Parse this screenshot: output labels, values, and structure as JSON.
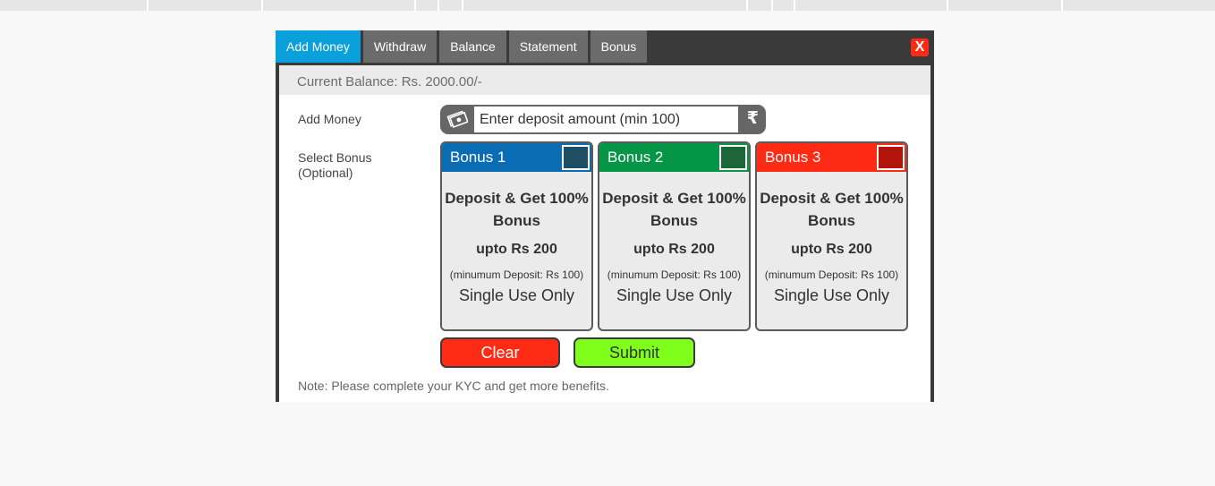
{
  "tabs": [
    {
      "label": "Add Money",
      "active": true
    },
    {
      "label": "Withdraw"
    },
    {
      "label": "Balance"
    },
    {
      "label": "Statement"
    },
    {
      "label": "Bonus"
    }
  ],
  "close_label": "X",
  "balance_text": "Current Balance: Rs. 2000.00/-",
  "form": {
    "add_money_label": "Add Money",
    "amount_placeholder": "Enter deposit amount (min 100)",
    "currency_symbol": "₹",
    "select_bonus_label_line1": "Select Bonus",
    "select_bonus_label_line2": "(Optional)"
  },
  "bonuses": [
    {
      "title": "Bonus 1",
      "line1": "Deposit & Get 100%",
      "line2": "Bonus",
      "upto": "upto Rs 200",
      "min": "(minumum Deposit: Rs 100)",
      "usage": "Single Use Only",
      "header_color": "#0a6db4",
      "check_color": "#1d4e63"
    },
    {
      "title": "Bonus 2",
      "line1": "Deposit & Get 100%",
      "line2": "Bonus",
      "upto": "upto Rs 200",
      "min": "(minumum Deposit: Rs 100)",
      "usage": "Single Use Only",
      "header_color": "#059547",
      "check_color": "#1c6638"
    },
    {
      "title": "Bonus 3",
      "line1": "Deposit & Get 100%",
      "line2": "Bonus",
      "upto": "upto Rs 200",
      "min": "(minumum Deposit: Rs 100)",
      "usage": "Single Use Only",
      "header_color": "#ff2a14",
      "check_color": "#b3140a"
    }
  ],
  "buttons": {
    "clear": "Clear",
    "submit": "Submit"
  },
  "note": "Note: Please complete your KYC and get more benefits.",
  "colors": {
    "active_tab": "#0aa0dc",
    "tab": "#6b6b6b",
    "modal_bg": "#3a3a3a",
    "clear": "#ff2b14",
    "submit": "#7fff1c"
  },
  "icons": {
    "amount_prefix": "money-icon",
    "amount_suffix": "rupee-icon",
    "close": "close-icon"
  }
}
